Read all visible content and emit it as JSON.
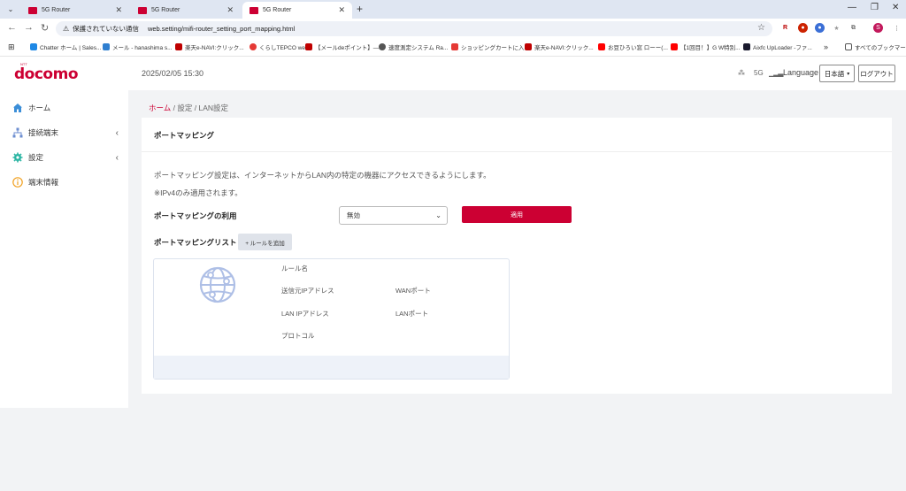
{
  "browser": {
    "tabs": [
      {
        "title": "5G Router",
        "active": false
      },
      {
        "title": "5G Router",
        "active": false
      },
      {
        "title": "5G Router",
        "active": true
      }
    ],
    "security_label": "保護されていない通信",
    "url": "web.setting/mifi-router_setting_port_mapping.html",
    "bookmarks": [
      "Chatter ホーム | Sales...",
      "メール - hanashima s...",
      "楽天e-NAVI:クリック...",
      "くらしTEPCO web",
      "【メールdeポイント】―...",
      "速度測定システム Ra...",
      "ショッピングカートに入...",
      "楽天e-NAVI:クリック...",
      "お豆ひろい窓 ローー(...",
      "【1回目！】G W特別...",
      "Aixfc UpLoader -ファ..."
    ],
    "bookmarks_more": "»",
    "all_bookmarks": "すべてのブックマーク"
  },
  "header": {
    "logo": "docomo",
    "logo_small": "NTT",
    "datetime": "2025/02/05 15:30",
    "network": "5G",
    "language_label": "Language",
    "language_value": "日本語",
    "logout": "ログアウト"
  },
  "sidebar": {
    "items": [
      {
        "label": "ホーム",
        "icon": "home-icon",
        "expandable": false
      },
      {
        "label": "接続端末",
        "icon": "network-icon",
        "expandable": true
      },
      {
        "label": "設定",
        "icon": "gear-icon",
        "expandable": true
      },
      {
        "label": "端末情報",
        "icon": "info-icon",
        "expandable": false
      }
    ]
  },
  "breadcrumb": {
    "home": "ホーム",
    "sep": "/",
    "level2": "設定",
    "level3": "LAN設定"
  },
  "page": {
    "title": "ポートマッピング",
    "description": "ポートマッピング設定は、インターネットからLAN内の特定の機器にアクセスできるようにします。",
    "note": "※IPv4のみ適用されます。",
    "usage_label": "ポートマッピングの利用",
    "usage_value": "無効",
    "apply": "適用",
    "list_label": "ポートマッピングリスト",
    "add_rule": "+ ルールを追加",
    "rule_fields": {
      "rule_name": "ルール名",
      "source_ip": "送信元IPアドレス",
      "wan_port": "WANポート",
      "lan_ip": "LAN IPアドレス",
      "lan_port": "LANポート",
      "protocol": "プロトコル"
    }
  },
  "colors": {
    "brand": "#cc0033",
    "page_bg": "#f2f3f5"
  }
}
